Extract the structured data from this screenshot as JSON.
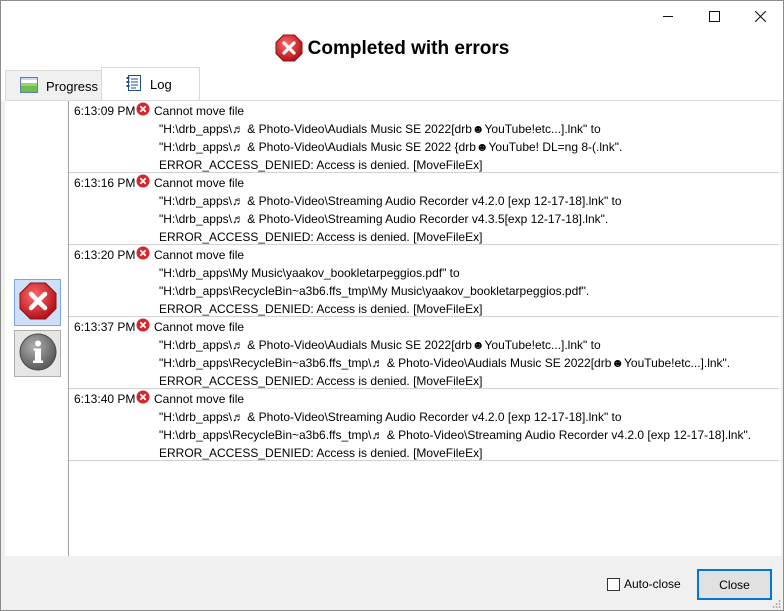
{
  "window": {
    "caption_buttons": [
      "minimize-icon",
      "maximize-icon",
      "close-icon"
    ]
  },
  "header": {
    "title": "Completed with errors",
    "icon": "error-icon"
  },
  "tabs": [
    {
      "label": "Progress",
      "icon": "chart-icon",
      "selected": false
    },
    {
      "label": "Log",
      "icon": "log-icon",
      "selected": true
    }
  ],
  "sidebar": {
    "filters": [
      {
        "name": "errors",
        "icon": "error-icon",
        "pressed": true
      },
      {
        "name": "info",
        "icon": "info-icon",
        "pressed": false
      }
    ]
  },
  "log": [
    {
      "time": "6:13:09 PM",
      "message": "Cannot move file",
      "line1": "\"H:\\drb_apps\\♬ & Photo-Video\\Audials Music SE 2022[drb☻YouTube!etc...].lnk\" to",
      "line2": "\"H:\\drb_apps\\♬ & Photo-Video\\Audials Music SE 2022 {drb☻YouTube! DL=ng 8-(.lnk\".",
      "line3": "ERROR_ACCESS_DENIED: Access is denied. [MoveFileEx]"
    },
    {
      "time": "6:13:16 PM",
      "message": "Cannot move file",
      "line1": "\"H:\\drb_apps\\♬ & Photo-Video\\Streaming Audio Recorder v4.2.0 [exp 12-17-18].lnk\" to",
      "line2": "\"H:\\drb_apps\\♬ & Photo-Video\\Streaming Audio Recorder v4.3.5[exp 12-17-18].lnk\".",
      "line3": "ERROR_ACCESS_DENIED: Access is denied. [MoveFileEx]"
    },
    {
      "time": "6:13:20 PM",
      "message": "Cannot move file",
      "line1": "\"H:\\drb_apps\\My Music\\yaakov_bookletarpeggios.pdf\" to",
      "line2": "\"H:\\drb_apps\\RecycleBin~a3b6.ffs_tmp\\My Music\\yaakov_bookletarpeggios.pdf\".",
      "line3": "ERROR_ACCESS_DENIED: Access is denied. [MoveFileEx]"
    },
    {
      "time": "6:13:37 PM",
      "message": "Cannot move file",
      "line1": "\"H:\\drb_apps\\♬ & Photo-Video\\Audials Music SE 2022[drb☻YouTube!etc...].lnk\" to",
      "line2": "\"H:\\drb_apps\\RecycleBin~a3b6.ffs_tmp\\♬ & Photo-Video\\Audials Music SE 2022[drb☻YouTube!etc...].lnk\".",
      "line3": "ERROR_ACCESS_DENIED: Access is denied. [MoveFileEx]"
    },
    {
      "time": "6:13:40 PM",
      "message": "Cannot move file",
      "line1": "\"H:\\drb_apps\\♬ & Photo-Video\\Streaming Audio Recorder v4.2.0 [exp 12-17-18].lnk\" to",
      "line2": "\"H:\\drb_apps\\RecycleBin~a3b6.ffs_tmp\\♬ & Photo-Video\\Streaming Audio Recorder v4.2.0 [exp 12-17-18].lnk\".",
      "line3": "ERROR_ACCESS_DENIED: Access is denied. [MoveFileEx]"
    }
  ],
  "footer": {
    "autoclose_label": "Auto-close",
    "autoclose_checked": false,
    "close_label": "Close"
  },
  "colors": {
    "error_red": "#d9242b",
    "accent_blue": "#0078d7"
  }
}
